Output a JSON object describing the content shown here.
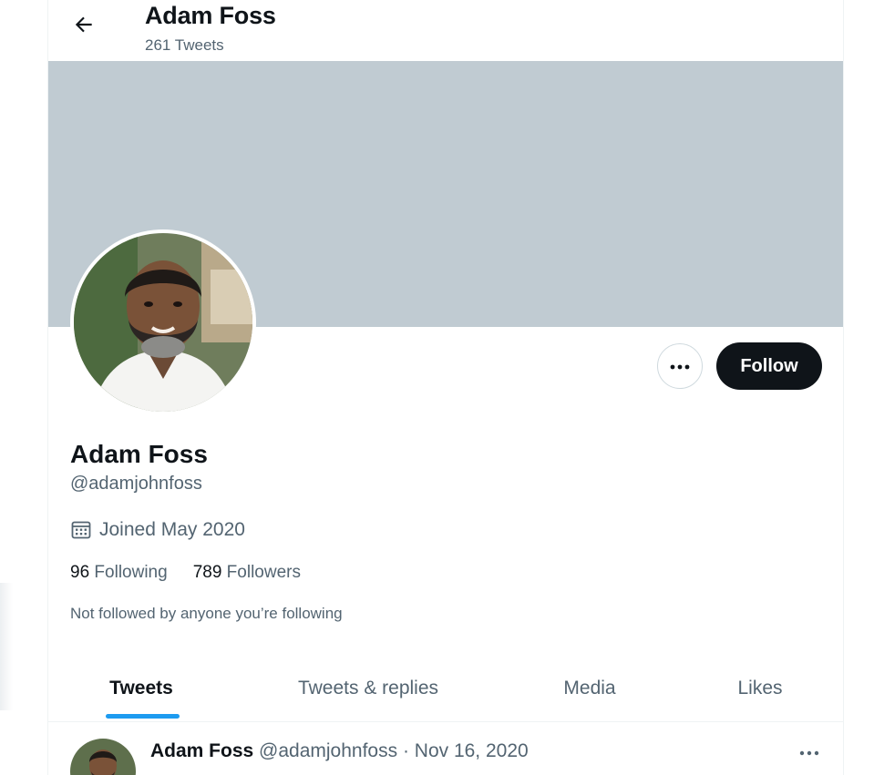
{
  "header": {
    "name": "Adam Foss",
    "tweet_count": "261 Tweets"
  },
  "profile": {
    "display_name": "Adam Foss",
    "handle": "@adamjohnfoss",
    "joined": "Joined May 2020",
    "following_count": "96",
    "following_label": "Following",
    "followers_count": "789",
    "followers_label": "Followers",
    "not_followed_note": "Not followed by anyone you’re following",
    "banner_color": "#c0cbd2"
  },
  "actions": {
    "more_icon": "more-horizontal-icon",
    "follow_label": "Follow"
  },
  "tabs": [
    {
      "label": "Tweets",
      "active": true
    },
    {
      "label": "Tweets & replies",
      "active": false
    },
    {
      "label": "Media",
      "active": false
    },
    {
      "label": "Likes",
      "active": false
    }
  ],
  "tweet": {
    "name": "Adam Foss",
    "handle_date": "@adamjohnfoss · Nov 16, 2020",
    "text": ""
  },
  "colors": {
    "accent": "#1d9bf0",
    "text_primary": "#0f1419",
    "text_secondary": "#536471",
    "follow_button": "#0f1419"
  }
}
